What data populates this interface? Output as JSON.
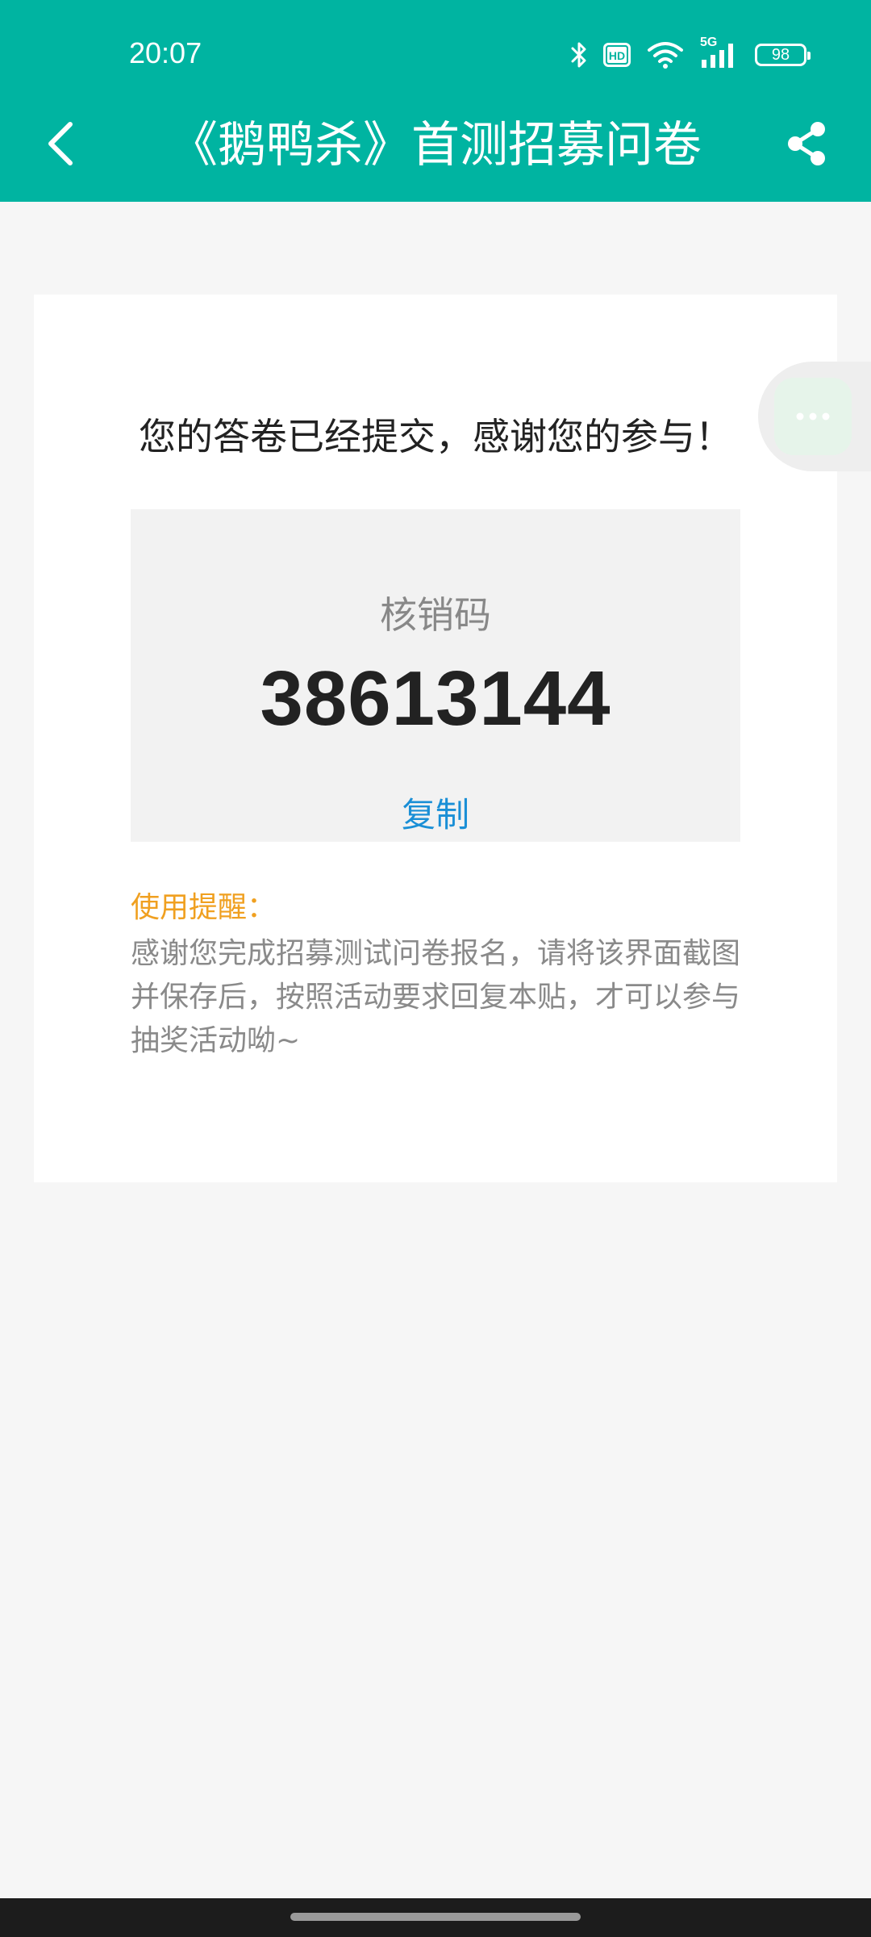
{
  "status_bar": {
    "time": "20:07",
    "network": "5G",
    "battery": "98",
    "hd_label": "HD"
  },
  "header": {
    "title": "《鹅鸭杀》首测招募问卷",
    "back_icon": "chevron-left-icon",
    "share_icon": "share-icon"
  },
  "result": {
    "message": "您的答卷已经提交，感谢您的参与！",
    "code_label": "核销码",
    "code_value": "38613144",
    "copy_label": "复制",
    "reminder_title": "使用提醒：",
    "reminder_text": "感谢您完成招募测试问卷报名，请将该界面截图并保存后，按照活动要求回复本贴，才可以参与抽奖活动呦~"
  },
  "floating_button": {
    "icon": "more-dots-icon"
  },
  "colors": {
    "header_bg": "#00b4a1",
    "page_bg": "#f6f6f6",
    "code_box_bg": "#f2f2f2",
    "copy_link": "#1a8fd6",
    "reminder_title": "#f0a020",
    "body_text": "#222222",
    "muted_text": "#8a8a8a"
  }
}
